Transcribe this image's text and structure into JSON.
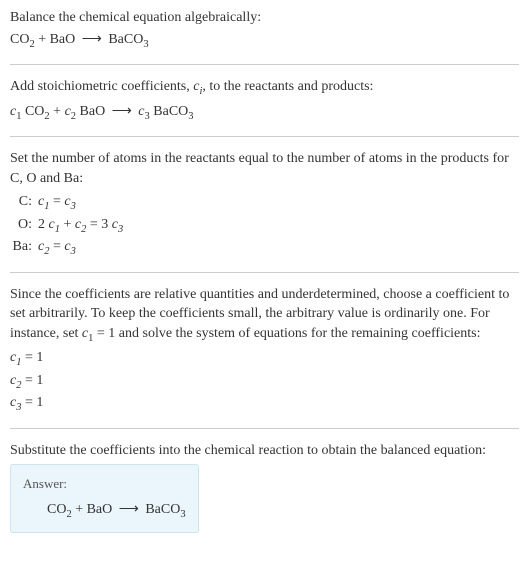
{
  "chart_data": {
    "type": "table",
    "title": "Balance the chemical equation algebraically",
    "reaction": {
      "reactants": [
        "CO2",
        "BaO"
      ],
      "products": [
        "BaCO3"
      ]
    },
    "stoichiometric_form": "c1 CO2 + c2 BaO → c3 BaCO3",
    "atom_balance": [
      {
        "element": "C",
        "equation": "c1 = c3"
      },
      {
        "element": "O",
        "equation": "2 c1 + c2 = 3 c3"
      },
      {
        "element": "Ba",
        "equation": "c2 = c3"
      }
    ],
    "solution": {
      "c1": 1,
      "c2": 1,
      "c3": 1
    },
    "balanced": "CO2 + BaO → BaCO3"
  },
  "intro": {
    "text": "Balance the chemical equation algebraically:",
    "eq_co2": "CO",
    "eq_co2_sub": "2",
    "eq_plus1": " + BaO ",
    "eq_arrow": "⟶",
    "eq_baco3": " BaCO",
    "eq_baco3_sub": "3"
  },
  "stoich": {
    "text_a": "Add stoichiometric coefficients, ",
    "ci": "c",
    "ci_sub": "i",
    "text_b": ", to the reactants and products:",
    "c1": "c",
    "c1_sub": "1",
    "co2": " CO",
    "co2_sub": "2",
    "plus": " + ",
    "c2": "c",
    "c2_sub": "2",
    "bao": " BaO ",
    "arrow": "⟶",
    "sp": " ",
    "c3": "c",
    "c3_sub": "3",
    "baco3": " BaCO",
    "baco3_sub": "3"
  },
  "atoms": {
    "text": "Set the number of atoms in the reactants equal to the number of atoms in the products for C, O and Ba:",
    "rows": [
      {
        "label": "C:",
        "c1": "c",
        "c1s": "1",
        "mid": " = ",
        "c3": "c",
        "c3s": "3",
        "prefix": "",
        "plus": "",
        "c2": "",
        "c2s": "",
        "rhs_coef": ""
      },
      {
        "label": "O:",
        "c1": "c",
        "c1s": "1",
        "mid": " = 3 ",
        "c3": "c",
        "c3s": "3",
        "prefix": "2 ",
        "plus": " + ",
        "c2": "c",
        "c2s": "2",
        "rhs_coef": ""
      },
      {
        "label": "Ba:",
        "c1": "",
        "c1s": "",
        "mid": " = ",
        "c3": "c",
        "c3s": "3",
        "prefix": "",
        "plus": "",
        "c2": "c",
        "c2s": "2",
        "rhs_coef": ""
      }
    ]
  },
  "solve": {
    "text_a": "Since the coefficients are relative quantities and underdetermined, choose a coefficient to set arbitrarily. To keep the coefficients small, the arbitrary value is ordinarily one. For instance, set ",
    "c1": "c",
    "c1_sub": "1",
    "text_b": " = 1 and solve the system of equations for the remaining coefficients:",
    "rows": [
      {
        "c": "c",
        "cs": "1",
        "val": " = 1"
      },
      {
        "c": "c",
        "cs": "2",
        "val": " = 1"
      },
      {
        "c": "c",
        "cs": "3",
        "val": " = 1"
      }
    ]
  },
  "subst": {
    "text": "Substitute the coefficients into the chemical reaction to obtain the balanced equation:"
  },
  "answer": {
    "label": "Answer:",
    "co2": "CO",
    "co2_sub": "2",
    "plus": " + BaO ",
    "arrow": "⟶",
    "baco3": " BaCO",
    "baco3_sub": "3"
  }
}
